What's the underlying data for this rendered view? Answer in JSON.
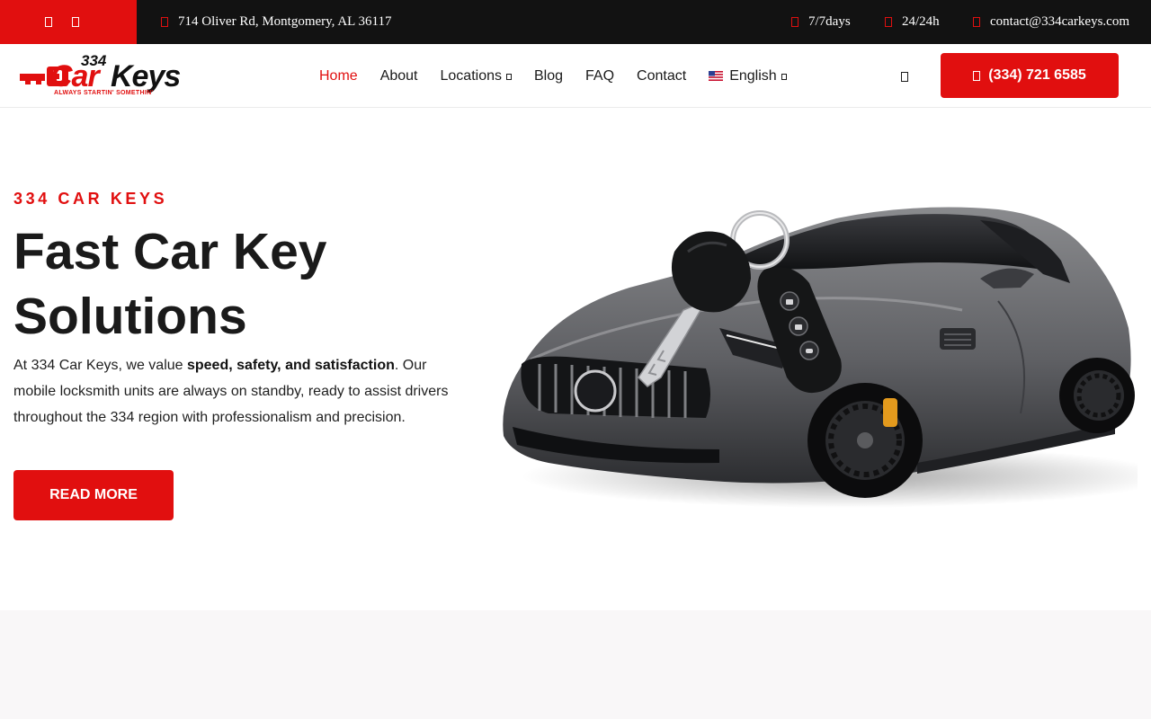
{
  "colors": {
    "accent": "#e10f0f",
    "topbar": "#121212",
    "text": "#1a1a1a",
    "band": "#f9f7f8"
  },
  "topbar": {
    "social": [
      {
        "icon": "facebook-icon"
      },
      {
        "icon": "instagram-icon"
      }
    ],
    "address": {
      "icon": "map-pin-icon",
      "text": "714 Oliver Rd, Montgomery, AL 36117"
    },
    "days": {
      "icon": "calendar-icon",
      "text": "7/7days"
    },
    "hours": {
      "icon": "clock-icon",
      "text": "24/24h"
    },
    "email": {
      "icon": "envelope-icon",
      "text": "contact@334carkeys.com"
    }
  },
  "header": {
    "logo": {
      "number": "334",
      "brand_red": "Car",
      "brand_black": "Keys",
      "tagline": "ALWAYS STARTIN' SOMETHIN'"
    },
    "nav": [
      {
        "label": "Home",
        "active": true
      },
      {
        "label": "About"
      },
      {
        "label": "Locations",
        "dropdown": true
      },
      {
        "label": "Blog"
      },
      {
        "label": "FAQ"
      },
      {
        "label": "Contact"
      },
      {
        "label": "English",
        "dropdown": true,
        "icon": "us-flag-icon"
      }
    ],
    "search_icon": "search-icon",
    "call_button": {
      "icon": "phone-icon",
      "label": "(334) 721 6585"
    }
  },
  "hero": {
    "eyebrow": "334 CAR KEYS",
    "title_line1": "Fast Car Key",
    "title_line2": "Solutions",
    "text_prefix": "At 334 Car Keys, we value ",
    "text_bold": "speed, safety, and satisfaction",
    "text_suffix": ". Our mobile locksmith units are always on standby, ready to assist drivers throughout the 334 region with professionalism and precision.",
    "button_label": "READ MORE",
    "image": "sports-car-with-keys"
  }
}
